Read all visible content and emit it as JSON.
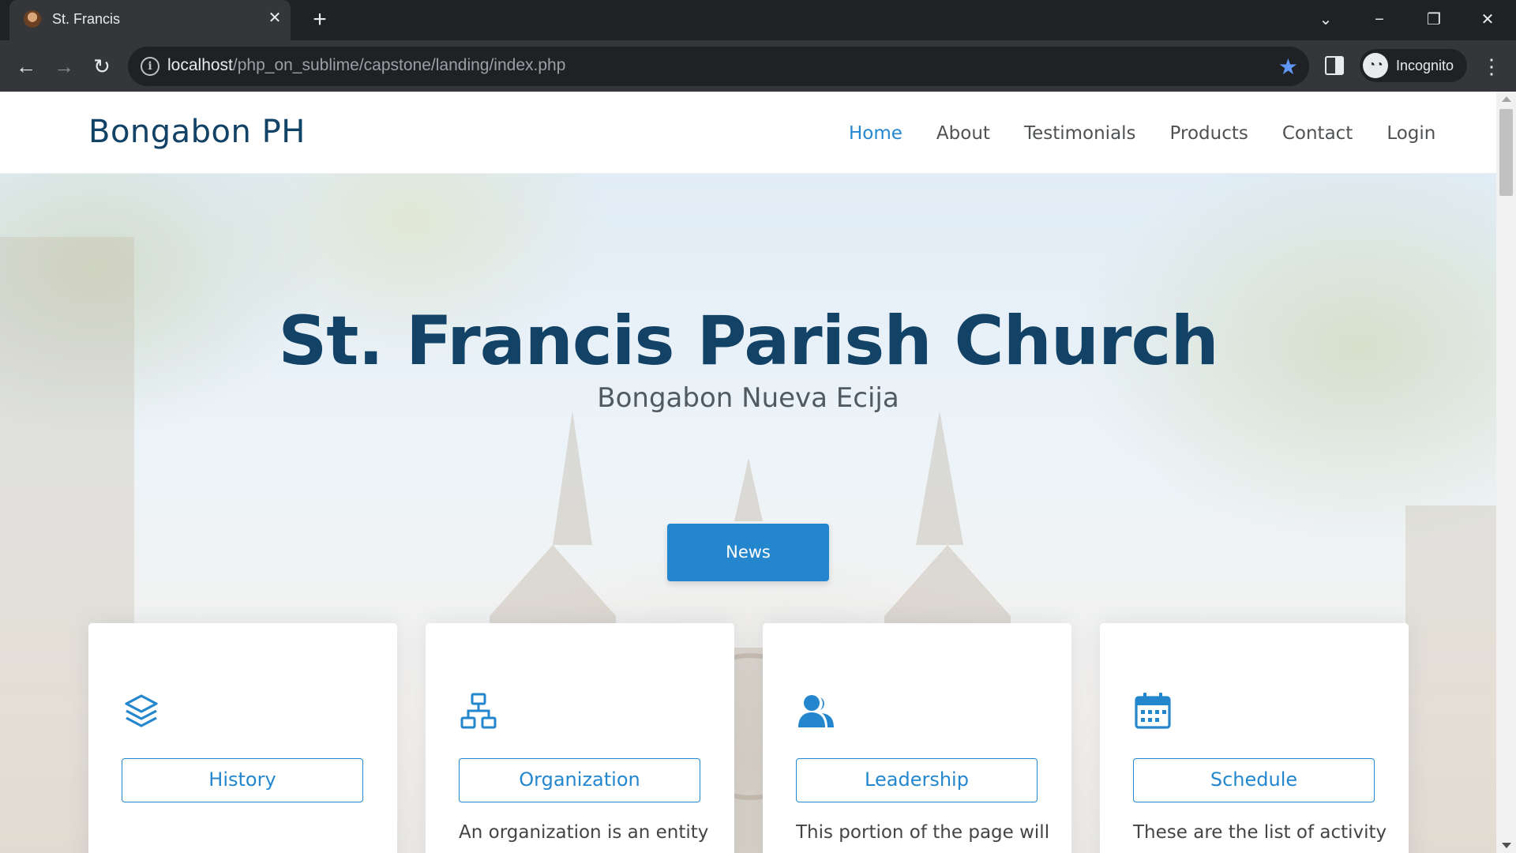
{
  "browser": {
    "tab_title": "St. Francis",
    "url_host": "localhost",
    "url_path": "/php_on_sublime/capstone/landing/index.php",
    "incognito_label": "Incognito",
    "accent": "#5e97f6"
  },
  "site": {
    "logo": "Bongabon PH",
    "nav": [
      "Home",
      "About",
      "Testimonials",
      "Products",
      "Contact",
      "Login"
    ],
    "active_nav": "Home",
    "primary_color": "#2487ce",
    "heading_color": "#124265"
  },
  "hero": {
    "title": "St. Francis Parish Church",
    "subtitle": "Bongabon Nueva Ecija",
    "button": "News"
  },
  "cards": [
    {
      "icon": "layers-icon",
      "button": "History",
      "text": ""
    },
    {
      "icon": "org-chart-icon",
      "button": "Organization",
      "text": "An organization is an entity"
    },
    {
      "icon": "people-icon",
      "button": "Leadership",
      "text": "This portion of the page will"
    },
    {
      "icon": "calendar-icon",
      "button": "Schedule",
      "text": "These are the list of activity"
    }
  ]
}
